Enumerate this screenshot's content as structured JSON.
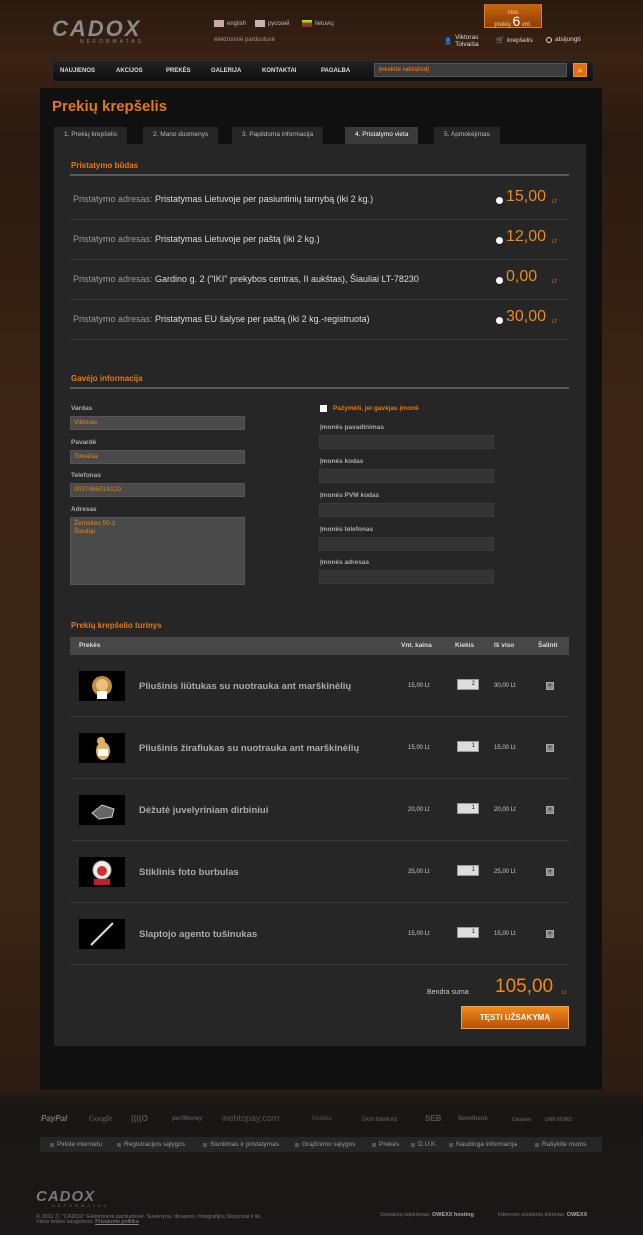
{
  "header": {
    "logo_text": "CADOX",
    "logo_sub": "NEFORMATAS",
    "languages": [
      {
        "label": "english",
        "color": "#c9a7a7"
      },
      {
        "label": "русский",
        "color": "#c9b3b3"
      },
      {
        "label": "lietuvių",
        "color": "#b8a84a"
      }
    ],
    "tagline": "elektroninė parduotuvė",
    "cart": {
      "line1": "viso",
      "line2": "prekių",
      "count": "6",
      "unit": "vnt."
    },
    "user_name": "Viktoras",
    "user_surname": "Tolvaiša",
    "cart_link": "krepšelis",
    "logout": "atsijungti"
  },
  "nav": {
    "items": [
      "NAUJIENOS",
      "AKCIJOS",
      "PREKĖS",
      "GALERIJA",
      "KONTAKTAI",
      "PAGALBA"
    ],
    "search_placeholder": "Įveskite raktažodį"
  },
  "page": {
    "title": "Prekių krepšelis",
    "tabs": [
      "1. Prekių krepšelis",
      "2. Mano duomenys",
      "3. Papildoma informacija",
      "4. Pristatymo vieta",
      "5. Apmokėjimas"
    ],
    "active_tab": 3
  },
  "delivery": {
    "title": "Pristatymo būdas",
    "label": "Pristatymo adresas:",
    "options": [
      {
        "text": "Pristatymas Lietuvoje per pasiuntinių tarnybą (iki 2 kg.)",
        "price": "15,00",
        "currency": "LT"
      },
      {
        "text": "Pristatymas Lietuvoje per paštą (iki 2 kg.)",
        "price": "12,00",
        "currency": "LT"
      },
      {
        "text": "Gardino g. 2 (\"IKI\" prekybos centras, II aukštas), Šiauliai LT-78230",
        "price": "0,00",
        "currency": "LT"
      },
      {
        "text": "Pristatymas EU šalyse per paštą (iki 2 kg.-registruota)",
        "price": "30,00",
        "currency": "LT"
      }
    ]
  },
  "recipient": {
    "title": "Gavėjo informacija",
    "name_label": "Vardas",
    "name_value": "Viktoras",
    "surname_label": "Pavardė",
    "surname_value": "Tolvaiša",
    "phone_label": "Telefonas",
    "phone_value": "0037065019120",
    "address_label": "Adresas",
    "address_line1": "Žemaitės 50-1",
    "address_line2": "Šiauliai",
    "company_check_label": "Pažymėti, jei gavėjas įmonė",
    "company_name_label": "Įmonės pavadinimas",
    "company_code_label": "Įmonės kodas",
    "company_vat_label": "Įmonės PVM kodas",
    "company_phone_label": "Įmonės telefonas",
    "company_address_label": "Įmonės adresas"
  },
  "cart": {
    "title": "Prekių krepšelio turinys",
    "headers": {
      "product": "Prekės",
      "unit_price": "Vnt. kaina",
      "qty": "Kiekis",
      "total": "Iš viso",
      "remove": "Šalinti"
    },
    "items": [
      {
        "name": "Pliušinis liūtukas su nuotrauka ant marškinėlių",
        "unit_price": "15,00 Lt",
        "qty": "2",
        "total": "30,00 Lt",
        "icon": "lion-plush-icon"
      },
      {
        "name": "Pliušinis žirafiukas su nuotrauka ant marškinėlių",
        "unit_price": "15,00 Lt",
        "qty": "1",
        "total": "15,00 Lt",
        "icon": "giraffe-plush-icon"
      },
      {
        "name": "Dėžutė juvelyriniam dirbiniui",
        "unit_price": "20,00 Lt",
        "qty": "1",
        "total": "20,00 Lt",
        "icon": "jewelry-box-icon"
      },
      {
        "name": "Stiklinis foto burbulas",
        "unit_price": "25,00 Lt",
        "qty": "1",
        "total": "25,00 Lt",
        "icon": "snow-globe-icon"
      },
      {
        "name": "Slaptojo agento tušinukas",
        "unit_price": "15,00 Lt",
        "qty": "1",
        "total": "15,00 Lt",
        "icon": "pen-icon"
      }
    ],
    "sum_label": "Bendra suma",
    "sum_value": "105,00",
    "sum_currency": "Lt",
    "order_button": "TĘSTI UŽSAKYMĄ"
  },
  "payment_logos": [
    "PayPal",
    "Google",
    "((((O",
    "perfMoney",
    "webtopay.com",
    "Nordea",
    "ŪKIO BANKAS",
    "SEB",
    "Swedbank",
    "Citadele",
    "DNB NORD"
  ],
  "footer": {
    "links": [
      "Pirkite internetu",
      "Registracijos sąlygos",
      "Siuntimas ir pristatymas",
      "Grąžinimo sąlygos",
      "Prekės",
      "D.U.K.",
      "Naudinga informacija",
      "Rašykite mums"
    ],
    "logo_text": "CADOX",
    "logo_sub": "NEFORMATAS",
    "copyright": "© 2011 Ⓒ \"CADOX\" Elektroninė parduotuvė. Suvenyrai, dovanos, fotografijos,Siurprizai ir kt.",
    "rights": "Visos teisės saugomos.",
    "privacy": "Privatumo politika",
    "design": "Svetainių talpinimas:",
    "design_brand": "OWEXX hosting",
    "creation": "Interneto svetainių kūrimas:",
    "creation_brand": "OWEXX"
  }
}
